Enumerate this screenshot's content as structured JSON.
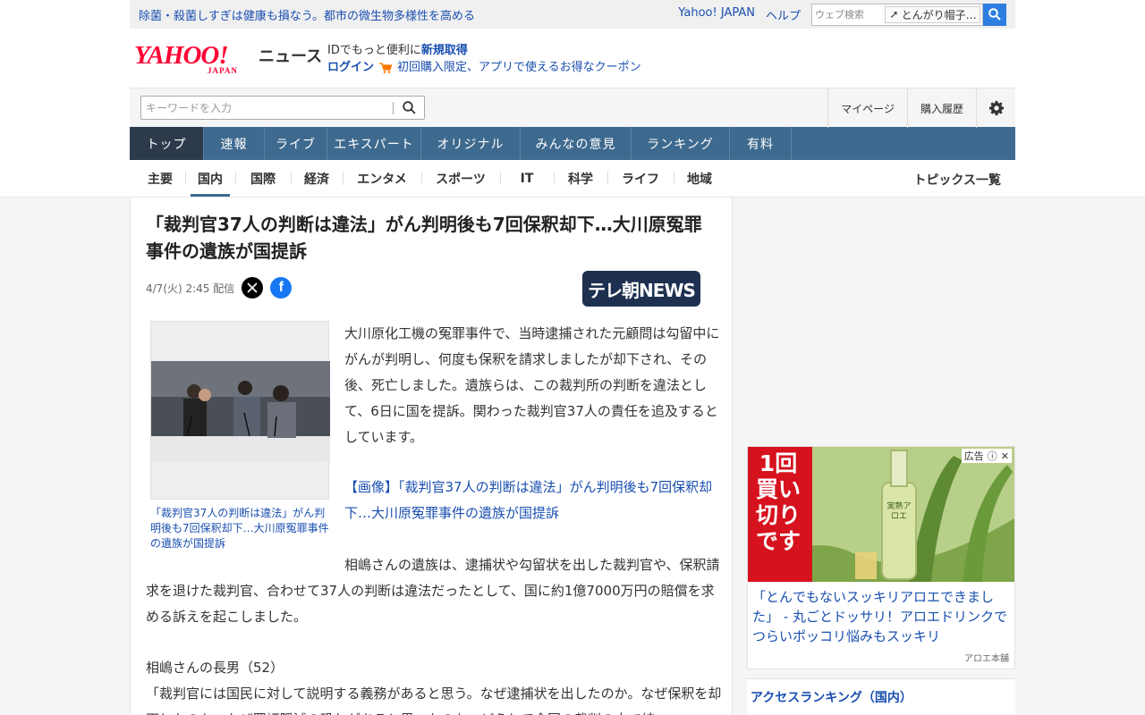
{
  "topbar": {
    "promo": "除菌・殺菌しすぎは健康も損なう。都市の微生物多様性を高める",
    "links": [
      "Yahoo! JAPAN",
      "ヘルプ"
    ],
    "web_search_placeholder": "ウェブ検索",
    "web_search_suggestion": "とんがり帽子…"
  },
  "header": {
    "logo_text": "YAHOO!",
    "logo_sub": "JAPAN",
    "section": "ニュース",
    "id_line_prefix": "IDでもっと便利に",
    "id_line_link": "新規取得",
    "login": "ログイン",
    "coupon": "初回購入限定、アプリで使えるお得なクーポン"
  },
  "search": {
    "placeholder": "キーワードを入力",
    "mypage": "マイページ",
    "history": "購入履歴"
  },
  "nav": {
    "items": [
      "トップ",
      "速報",
      "ライブ",
      "エキスパート",
      "オリジナル",
      "みんなの意見",
      "ランキング",
      "有料"
    ],
    "active": "トップ"
  },
  "categories": {
    "items": [
      "主要",
      "国内",
      "国際",
      "経済",
      "エンタメ",
      "スポーツ",
      "IT",
      "科学",
      "ライフ",
      "地域"
    ],
    "active": "国内",
    "topics_link": "トピックス一覧"
  },
  "article": {
    "title": "「裁判官37人の判断は違法」がん判明後も7回保釈却下…大川原冤罪事件の遺族が国提訴",
    "date": "4/7(火) 2:45 配信",
    "source": "テレ朝NEWS",
    "photo_caption": "「裁判官37人の判断は違法」がん判明後も7回保釈却下…大川原冤罪事件の遺族が国提訴",
    "paragraph1": "大川原化工機の冤罪事件で、当時逮捕された元顧問は勾留中にがんが判明し、何度も保釈を請求しましたが却下され、その後、死亡しました。遺族らは、この裁判所の判断を違法として、6日に国を提訴。関わった裁判官37人の責任を追及するとしています。",
    "image_link": "【画像】「裁判官37人の判断は違法」がん判明後も7回保釈却下…大川原冤罪事件の遺族が国提訴",
    "paragraph2": "相嶋さんの遺族は、逮捕状や勾留状を出した裁判官や、保釈請求を退けた裁判官、合わせて37人の判断は違法だったとして、国に約1億7000万円の賠償を求める訴えを起こしました。",
    "speaker": "相嶋さんの長男（52）",
    "quote": "「裁判官には国民に対して説明する義務があると思う。なぜ逮捕状を出したのか。なぜ保釈を却下したのか。なぜ罪証隠滅の恐れがあると思ったのか。どうして全国の裁判の中で結"
  },
  "ad": {
    "badge": "広告",
    "headline": "「とんでもないスッキリアロエできました」 - 丸ごとドッサリ！アロエドリンクでつらいポッコリ悩みもスッキリ",
    "sponsor": "アロエ本舗",
    "banner_text": "1回買い切りです",
    "bottle_label": "実熟アロエ"
  },
  "ranking": {
    "title": "アクセスランキング（国内）"
  }
}
